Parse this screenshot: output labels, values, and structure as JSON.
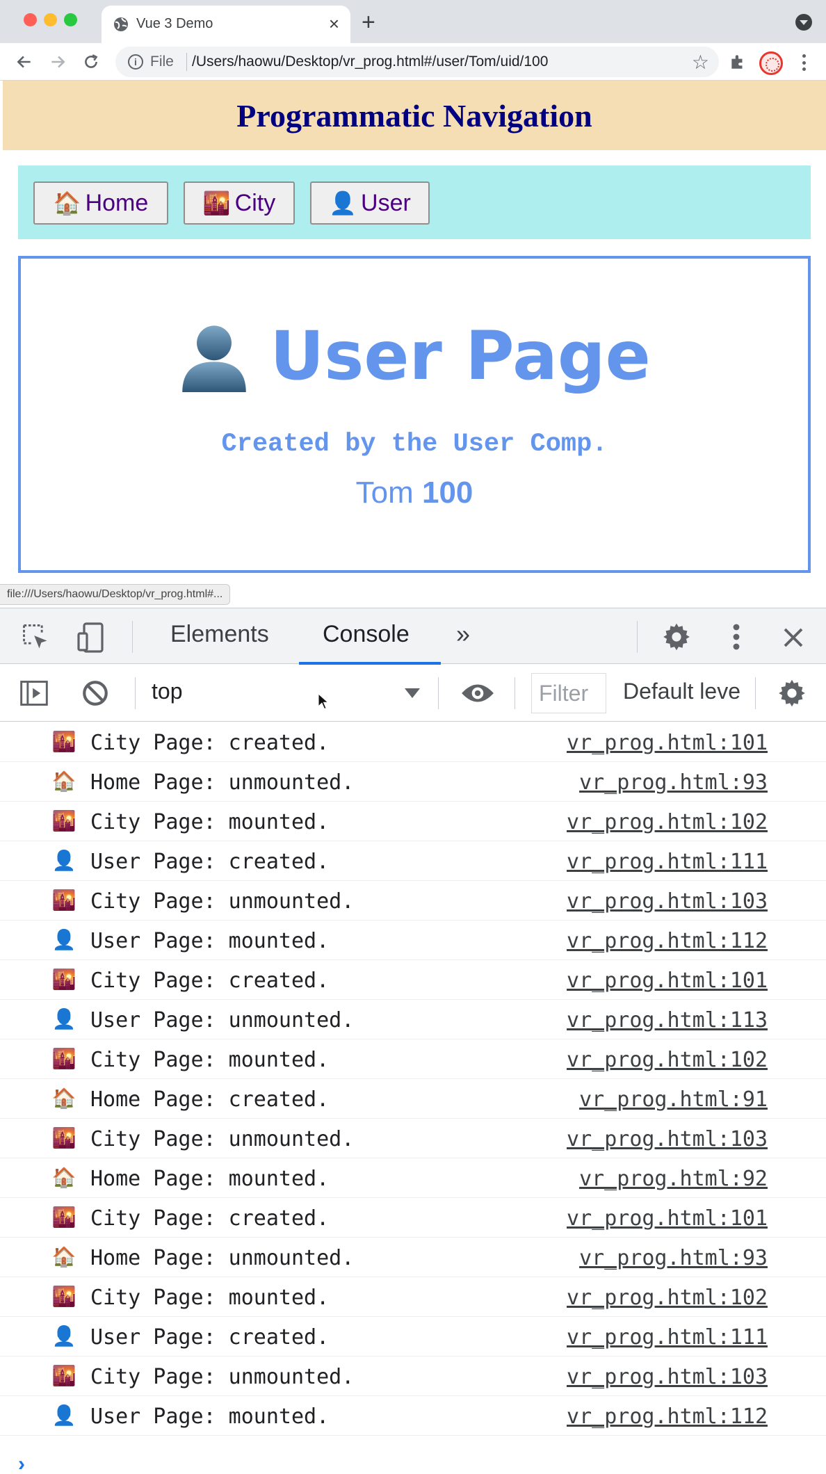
{
  "browser": {
    "tab_title": "Vue 3 Demo",
    "tab_close": "×",
    "new_tab": "+",
    "scheme_label": "File",
    "url": "/Users/haowu/Desktop/vr_prog.html#/user/Tom/uid/100",
    "status_url": "file:///Users/haowu/Desktop/vr_prog.html#..."
  },
  "page": {
    "header_title": "Programmatic Navigation",
    "nav": [
      {
        "emoji": "🏠",
        "label": "Home"
      },
      {
        "emoji": "🌇",
        "label": "City"
      },
      {
        "emoji": "👤",
        "label": "User"
      }
    ],
    "title": "User Page",
    "subtitle": "Created by the User Comp.",
    "user_name": "Tom",
    "user_id": "100"
  },
  "devtools": {
    "tabs": {
      "elements": "Elements",
      "console": "Console",
      "more": "»"
    },
    "context": "top",
    "filter_placeholder": "Filter",
    "levels": "Default levels",
    "prompt": "›",
    "logs": [
      {
        "emoji": "🌇",
        "message": "City Page: created.",
        "source": "vr_prog.html:101"
      },
      {
        "emoji": "🏠",
        "message": "Home Page: unmounted.",
        "source": "vr_prog.html:93"
      },
      {
        "emoji": "🌇",
        "message": "City Page: mounted.",
        "source": "vr_prog.html:102"
      },
      {
        "emoji": "👤",
        "message": "User Page: created.",
        "source": "vr_prog.html:111"
      },
      {
        "emoji": "🌇",
        "message": "City Page: unmounted.",
        "source": "vr_prog.html:103"
      },
      {
        "emoji": "👤",
        "message": "User Page: mounted.",
        "source": "vr_prog.html:112"
      },
      {
        "emoji": "🌇",
        "message": "City Page: created.",
        "source": "vr_prog.html:101"
      },
      {
        "emoji": "👤",
        "message": "User Page: unmounted.",
        "source": "vr_prog.html:113"
      },
      {
        "emoji": "🌇",
        "message": "City Page: mounted.",
        "source": "vr_prog.html:102"
      },
      {
        "emoji": "🏠",
        "message": "Home Page: created.",
        "source": "vr_prog.html:91"
      },
      {
        "emoji": "🌇",
        "message": "City Page: unmounted.",
        "source": "vr_prog.html:103"
      },
      {
        "emoji": "🏠",
        "message": "Home Page: mounted.",
        "source": "vr_prog.html:92"
      },
      {
        "emoji": "🌇",
        "message": "City Page: created.",
        "source": "vr_prog.html:101"
      },
      {
        "emoji": "🏠",
        "message": "Home Page: unmounted.",
        "source": "vr_prog.html:93"
      },
      {
        "emoji": "🌇",
        "message": "City Page: mounted.",
        "source": "vr_prog.html:102"
      },
      {
        "emoji": "👤",
        "message": "User Page: created.",
        "source": "vr_prog.html:111"
      },
      {
        "emoji": "🌇",
        "message": "City Page: unmounted.",
        "source": "vr_prog.html:103"
      },
      {
        "emoji": "👤",
        "message": "User Page: mounted.",
        "source": "vr_prog.html:112"
      }
    ]
  }
}
